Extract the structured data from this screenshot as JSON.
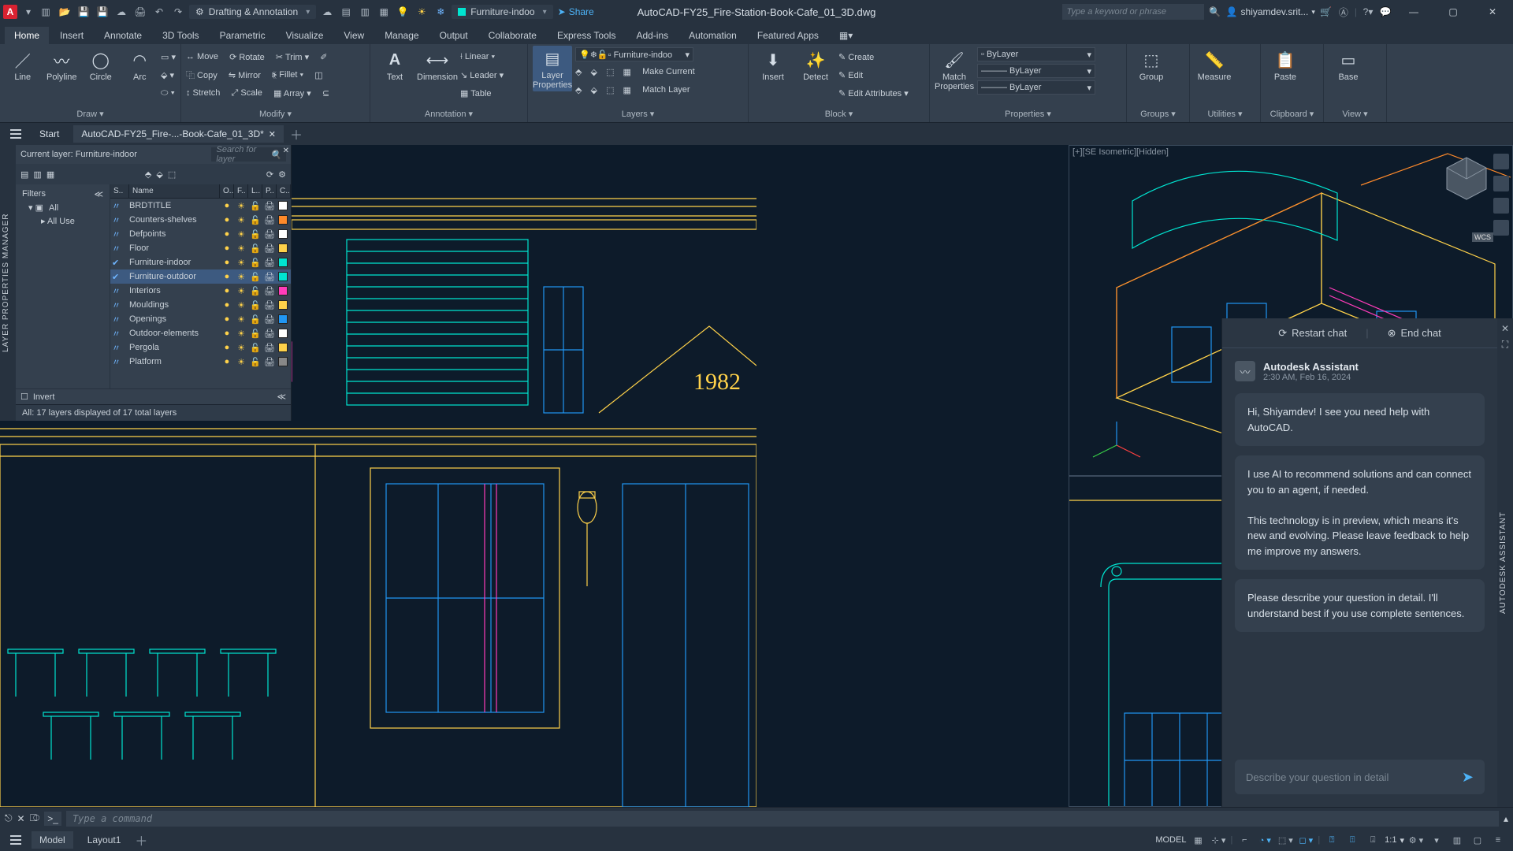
{
  "app": {
    "letter": "A",
    "workspace": "Drafting & Annotation",
    "share": "Share",
    "document_title": "AutoCAD-FY25_Fire-Station-Book-Cafe_01_3D.dwg",
    "search_placeholder": "Type a keyword or phrase",
    "user": "shiyamdev.srit..."
  },
  "menus": [
    "Home",
    "Insert",
    "Annotate",
    "3D Tools",
    "Parametric",
    "Visualize",
    "View",
    "Manage",
    "Output",
    "Collaborate",
    "Express Tools",
    "Add-ins",
    "Automation",
    "Featured Apps"
  ],
  "ribbon": {
    "draw": {
      "label": "Draw ▾",
      "tools": [
        "Line",
        "Polyline",
        "Circle",
        "Arc"
      ]
    },
    "modify": {
      "label": "Modify ▾",
      "rows": [
        [
          "↔ Move",
          "⟳ Rotate",
          "✂ Trim ▾"
        ],
        [
          "⿻ Copy",
          "⇋ Mirror",
          "⦕ Fillet ▾"
        ],
        [
          "↕ Stretch",
          "⤢ Scale",
          "▦ Array ▾"
        ]
      ]
    },
    "annotation": {
      "label": "Annotation ▾",
      "text": "Text",
      "dim": "Dimension",
      "rows": [
        "⟊ Linear ▾",
        "↘ Leader ▾",
        "▦ Table"
      ]
    },
    "layers": {
      "label": "Layers ▾",
      "props": "Layer Properties",
      "current": "Furniture-indoo",
      "rows": [
        "Make Current",
        "Match Layer"
      ]
    },
    "block": {
      "label": "Block ▾",
      "insert": "Insert",
      "detect": "Detect",
      "rows": [
        "✎ Create",
        "✎ Edit",
        "✎ Edit Attributes ▾"
      ]
    },
    "properties": {
      "label": "Properties ▾",
      "match": "Match Properties",
      "dd": [
        "ByLayer",
        "——— ByLayer",
        "——— ByLayer"
      ]
    },
    "groups": "Groups ▾",
    "utilities": "Utilities ▾",
    "measure": "Measure",
    "clipboard": "Clipboard ▾",
    "paste": "Paste",
    "view": "View ▾",
    "base": "Base"
  },
  "file_tabs": {
    "start": "Start",
    "active": "AutoCAD-FY25_Fire-...-Book-Cafe_01_3D*"
  },
  "layer_panel": {
    "title": "LAYER PROPERTIES MANAGER",
    "current": "Current layer: Furniture-indoor",
    "search": "Search for layer",
    "filters": "Filters",
    "all": "All",
    "all_used": "All Use",
    "cols": [
      "S..",
      "Name",
      "O..",
      "F..",
      "L..",
      "P..",
      "C.."
    ],
    "layers": [
      {
        "n": "BRDTITLE",
        "c": "#ffffff"
      },
      {
        "n": "Counters-shelves",
        "c": "#ff8a2a"
      },
      {
        "n": "Defpoints",
        "c": "#ffffff"
      },
      {
        "n": "Floor",
        "c": "#ffd24a"
      },
      {
        "n": "Furniture-indoor",
        "c": "#00e5d1",
        "on": true
      },
      {
        "n": "Furniture-outdoor",
        "c": "#00e5d1",
        "sel": true,
        "on": true
      },
      {
        "n": "Interiors",
        "c": "#ff3cba"
      },
      {
        "n": "Mouldings",
        "c": "#ffd24a"
      },
      {
        "n": "Openings",
        "c": "#2196f3"
      },
      {
        "n": "Outdoor-elements",
        "c": "#ffffff"
      },
      {
        "n": "Pergola",
        "c": "#ffd24a"
      },
      {
        "n": "Platform",
        "c": "#888888"
      }
    ],
    "invert": "Invert",
    "status": "All: 17 layers displayed of 17 total layers"
  },
  "viewport": {
    "iso_label": "[+][SE Isometric][Hidden]",
    "wcs": "WCS",
    "year": "1982"
  },
  "cmd": {
    "placeholder": "Type a command",
    "prompt": ">_"
  },
  "status": {
    "model": "Model",
    "layout": "Layout1",
    "model_btn": "MODEL",
    "scale": "1:1"
  },
  "assistant": {
    "side": "AUTODESK ASSISTANT",
    "restart": "Restart chat",
    "end": "End chat",
    "name": "Autodesk Assistant",
    "time": "2:30 AM, Feb 16, 2024",
    "b1": "Hi, Shiyamdev! I see you need help with AutoCAD.",
    "b2": "I use AI to recommend solutions and can connect you to an agent, if needed.",
    "b3": "This technology is in preview, which means it's new and evolving. Please leave feedback to help me improve my answers.",
    "b4": "Please describe your question in detail. I'll understand best if you use complete sentences.",
    "input": "Describe your question in detail"
  }
}
